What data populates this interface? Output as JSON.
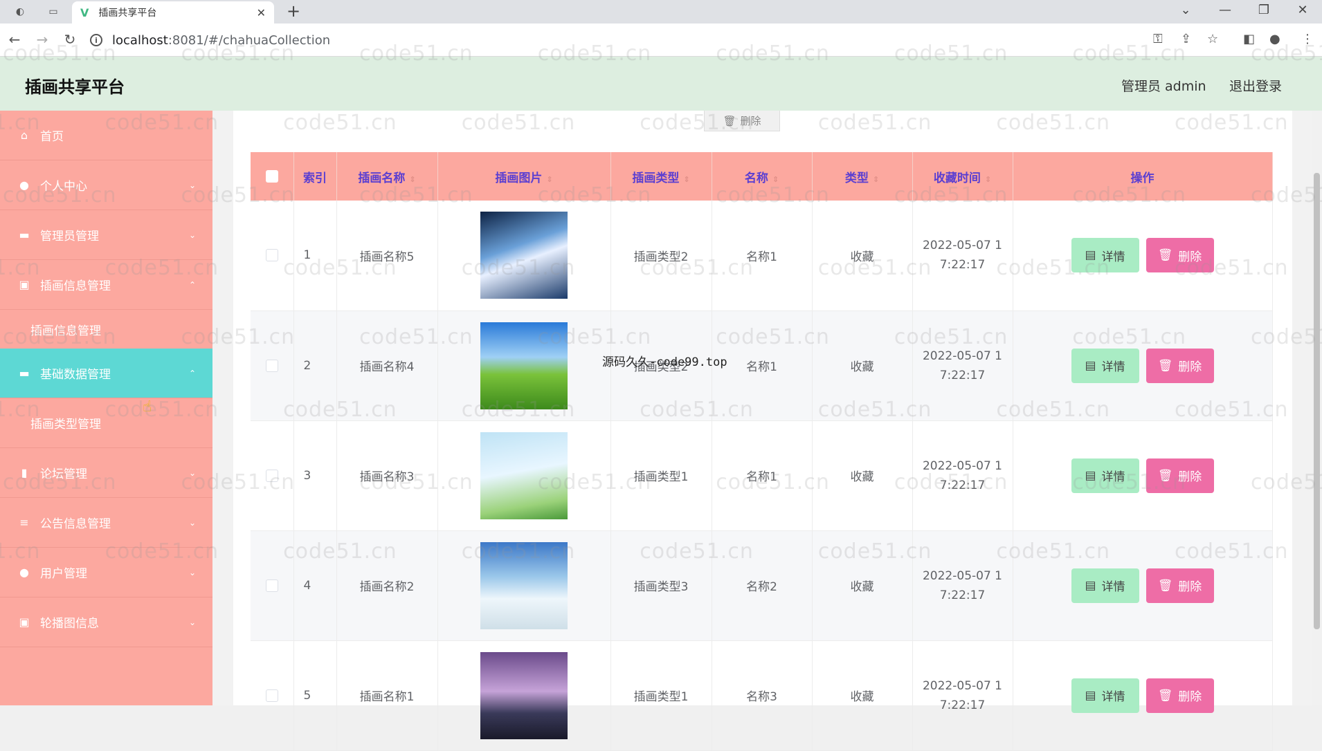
{
  "browser": {
    "tab_title": "插画共享平台",
    "url_host": "localhost",
    "url_path": ":8081/#/chahuaCollection"
  },
  "header": {
    "title": "插画共享平台",
    "user": "管理员 admin",
    "logout": "退出登录"
  },
  "sidebar": {
    "items": [
      {
        "label": "首页",
        "icon": "home-icon"
      },
      {
        "label": "个人中心",
        "icon": "user-icon"
      },
      {
        "label": "管理员管理",
        "icon": "folder-icon"
      },
      {
        "label": "插画信息管理",
        "icon": "clipboard-icon"
      },
      {
        "label": "插画信息管理"
      },
      {
        "label": "基础数据管理",
        "icon": "storage-icon"
      },
      {
        "label": "插画类型管理"
      },
      {
        "label": "论坛管理",
        "icon": "chart-icon"
      },
      {
        "label": "公告信息管理",
        "icon": "list-icon"
      },
      {
        "label": "用户管理",
        "icon": "user-icon"
      },
      {
        "label": "轮播图信息",
        "icon": "clipboard-icon"
      }
    ]
  },
  "toolbar": {
    "delete_label": "删除"
  },
  "table": {
    "columns": [
      "索引",
      "插画名称",
      "插画图片",
      "插画类型",
      "名称",
      "类型",
      "收藏时间",
      "操作"
    ],
    "detail_label": "详情",
    "delete_label": "删除",
    "rows": [
      {
        "index": "1",
        "name": "插画名称5",
        "type": "插画类型2",
        "title": "名称1",
        "kind": "收藏",
        "time1": "2022-05-07 1",
        "time2": "7:22:17"
      },
      {
        "index": "2",
        "name": "插画名称4",
        "type": "插画类型2",
        "title": "名称1",
        "kind": "收藏",
        "time1": "2022-05-07 1",
        "time2": "7:22:17"
      },
      {
        "index": "3",
        "name": "插画名称3",
        "type": "插画类型1",
        "title": "名称1",
        "kind": "收藏",
        "time1": "2022-05-07 1",
        "time2": "7:22:17"
      },
      {
        "index": "4",
        "name": "插画名称2",
        "type": "插画类型3",
        "title": "名称2",
        "kind": "收藏",
        "time1": "2022-05-07 1",
        "time2": "7:22:17"
      },
      {
        "index": "5",
        "name": "插画名称1",
        "type": "插画类型1",
        "title": "名称3",
        "kind": "收藏",
        "time1": "2022-05-07 1",
        "time2": "7:22:17"
      }
    ]
  },
  "overlay": "源码久久-code99.top",
  "watermark": "code51.cn"
}
